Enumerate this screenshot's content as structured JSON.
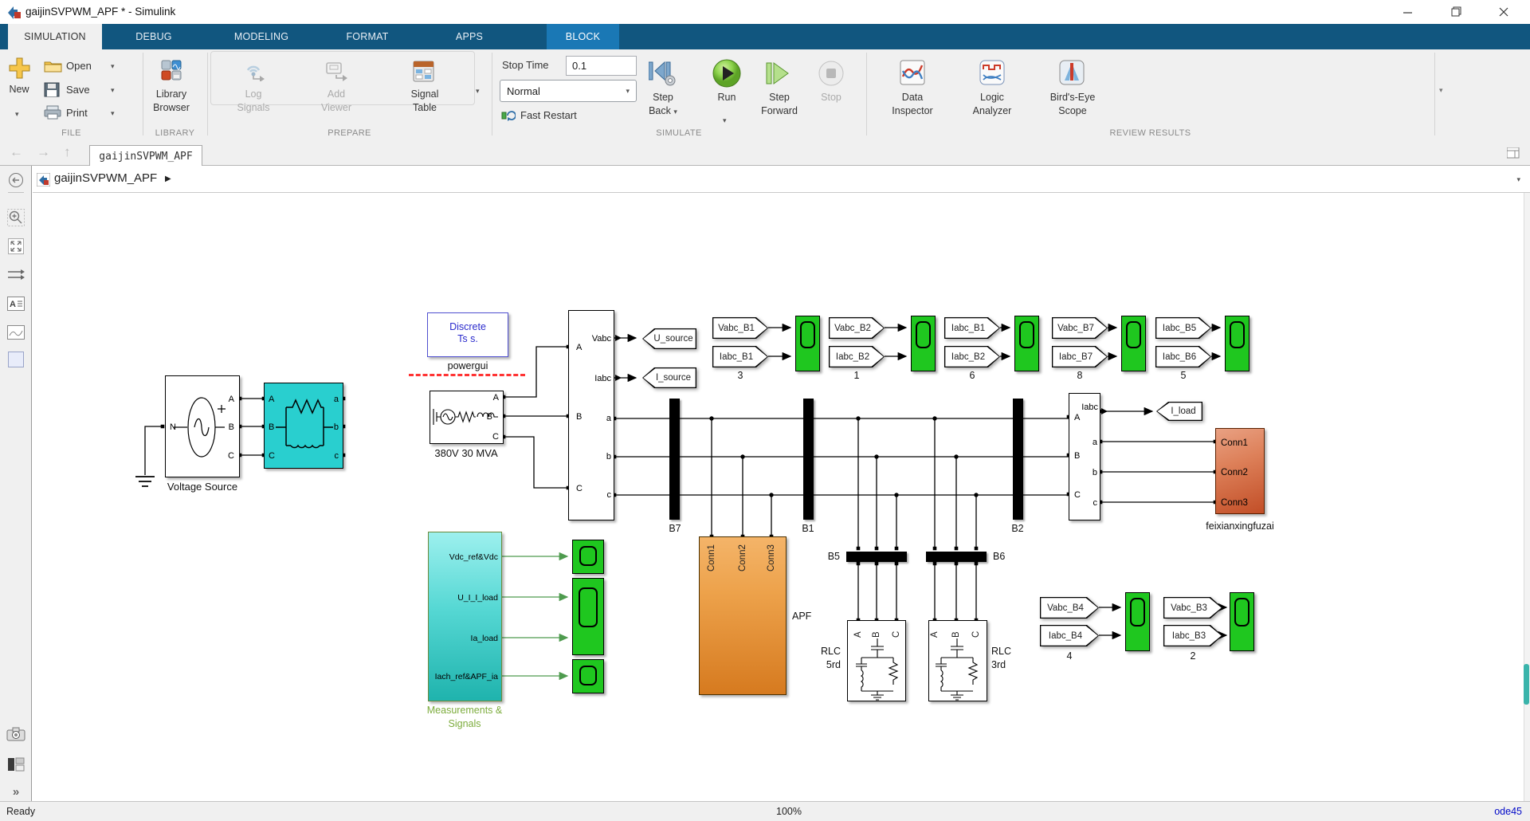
{
  "titlebar": {
    "title": "gaijinSVPWM_APF * - Simulink"
  },
  "ribbon": {
    "tabs": [
      "SIMULATION",
      "DEBUG",
      "MODELING",
      "FORMAT",
      "APPS",
      "BLOCK"
    ]
  },
  "toolbar": {
    "file": {
      "label": "FILE",
      "new": "New",
      "open": "Open",
      "save": "Save",
      "print": "Print"
    },
    "library": {
      "label": "LIBRARY",
      "browser1": "Library",
      "browser2": "Browser"
    },
    "prepare": {
      "label": "PREPARE",
      "log1": "Log",
      "log2": "Signals",
      "add1": "Add",
      "add2": "Viewer",
      "table1": "Signal",
      "table2": "Table"
    },
    "simulate": {
      "label": "SIMULATE",
      "stop_time_label": "Stop Time",
      "stop_time_value": "0.1",
      "mode": "Normal",
      "fast_restart": "Fast Restart",
      "step": "Step",
      "back": "Back",
      "run": "Run",
      "forward": "Forward",
      "stop": "Stop"
    },
    "review": {
      "label": "REVIEW RESULTS",
      "di1": "Data",
      "di2": "Inspector",
      "la1": "Logic",
      "la2": "Analyzer",
      "be1": "Bird's-Eye",
      "be2": "Scope"
    }
  },
  "navbar": {
    "tab": "gaijinSVPWM_APF"
  },
  "breadcrumb": {
    "model": "gaijinSVPWM_APF",
    "arrow": "▶"
  },
  "diagram": {
    "powergui": {
      "line1": "Discrete",
      "line2": "Ts s.",
      "name": "powergui"
    },
    "vsource": {
      "name": "Voltage Source",
      "n": "N",
      "a": "A",
      "b": "B",
      "c": "C",
      "plus": "+"
    },
    "rl": {
      "a": "A",
      "b": "B",
      "c": "C",
      "oa": "a",
      "ob": "b",
      "oc": "c"
    },
    "grid": {
      "name": "380V 30 MVA",
      "a": "A",
      "b": "B",
      "c": "C"
    },
    "vimeas": {
      "vabc": "Vabc",
      "iabc": "Iabc",
      "a": "A",
      "b": "B",
      "c": "C",
      "oa": "a",
      "ob": "b",
      "oc": "c"
    },
    "usource": "U_source",
    "isource": "I_source",
    "iload": "I_load",
    "groups": [
      {
        "t1": "Vabc_B1",
        "t2": "Iabc_B1",
        "n": "3"
      },
      {
        "t1": "Vabc_B2",
        "t2": "Iabc_B2",
        "n": "1"
      },
      {
        "t1": "Iabc_B1",
        "t2": "Iabc_B2",
        "n": "6"
      },
      {
        "t1": "Vabc_B7",
        "t2": "Iabc_B7",
        "n": "8"
      },
      {
        "t1": "Iabc_B5",
        "t2": "Iabc_B6",
        "n": "5"
      },
      {
        "t1": "Vabc_B4",
        "t2": "Iabc_B4",
        "n": "4"
      },
      {
        "t1": "Vabc_B3",
        "t2": "Iabc_B3",
        "n": "2"
      }
    ],
    "buses": {
      "b7": "B7",
      "b1": "B1",
      "b2": "B2",
      "b5": "B5",
      "b6": "B6"
    },
    "loadmeas": {
      "iabc": "Iabc",
      "a": "A",
      "b": "B",
      "c": "C",
      "oa": "a",
      "ob": "b",
      "oc": "c"
    },
    "load": {
      "c1": "Conn1",
      "c2": "Conn2",
      "c3": "Conn3",
      "name": "feixianxingfuzai"
    },
    "apf": {
      "c1": "Conn1",
      "c2": "Conn2",
      "c3": "Conn3",
      "name": "APF"
    },
    "rlc5": {
      "a": "A",
      "b": "B",
      "c": "C",
      "n1": "RLC",
      "n2": "5rd"
    },
    "rlc3": {
      "a": "A",
      "b": "B",
      "c": "C",
      "n1": "RLC",
      "n2": "3rd"
    },
    "meas": {
      "p1": "Vdc_ref&Vdc",
      "p2": "U_I_I_load",
      "p3": "Ia_load",
      "p4": "Iach_ref&APF_ia",
      "n1": "Measurements &",
      "n2": "Signals"
    }
  },
  "statusbar": {
    "status": "Ready",
    "zoom": "100%",
    "solver": "ode45"
  }
}
